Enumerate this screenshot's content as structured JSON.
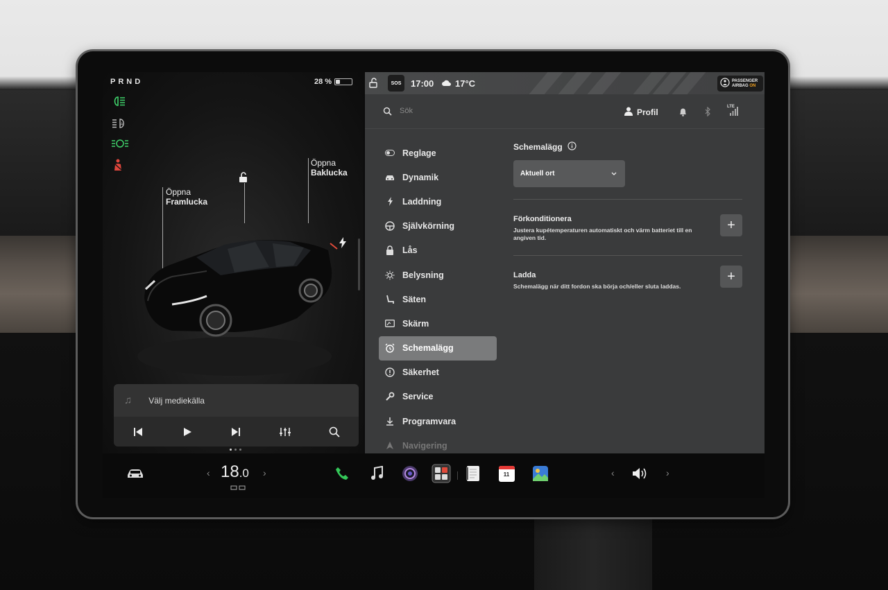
{
  "left_panel": {
    "gear": "PRND",
    "battery_percent": "28 %",
    "battery_level": 0.28,
    "labels": {
      "front_trunk_line1": "Öppna",
      "front_trunk_line2": "Framlucka",
      "rear_trunk_line1": "Öppna",
      "rear_trunk_line2": "Baklucka"
    },
    "telltales": [
      "headlight-icon",
      "auto-highbeam-icon",
      "parking-light-icon",
      "seatbelt-warning-icon"
    ],
    "media": {
      "source_label": "Välj mediekälla"
    }
  },
  "status_bar": {
    "time": "17:00",
    "temperature": "17°C",
    "sos": "SOS",
    "airbag_line1": "PASSENGER",
    "airbag_line2": "AIRBAG",
    "airbag_state": "ON"
  },
  "header": {
    "search_placeholder": "Sök",
    "profile": "Profil",
    "network": "LTE"
  },
  "menu": {
    "items": [
      {
        "label": "Reglage",
        "icon": "toggle-icon"
      },
      {
        "label": "Dynamik",
        "icon": "car-icon"
      },
      {
        "label": "Laddning",
        "icon": "bolt-icon"
      },
      {
        "label": "Självkörning",
        "icon": "steering-wheel-icon"
      },
      {
        "label": "Lås",
        "icon": "lock-icon"
      },
      {
        "label": "Belysning",
        "icon": "sun-icon"
      },
      {
        "label": "Säten",
        "icon": "seat-icon"
      },
      {
        "label": "Skärm",
        "icon": "screen-icon"
      },
      {
        "label": "Schemalägg",
        "icon": "alarm-clock-icon",
        "active": true
      },
      {
        "label": "Säkerhet",
        "icon": "info-circle-icon"
      },
      {
        "label": "Service",
        "icon": "wrench-icon"
      },
      {
        "label": "Programvara",
        "icon": "download-icon"
      },
      {
        "label": "Navigering",
        "icon": "navigation-icon"
      }
    ]
  },
  "content": {
    "section_title": "Schemalägg",
    "dropdown_value": "Aktuell ort",
    "rows": [
      {
        "title": "Förkonditionera",
        "desc": "Justera kupétemperaturen automatiskt och värm batteriet till en angiven tid."
      },
      {
        "title": "Ladda",
        "desc": "Schemalägg när ditt fordon ska börja och/eller sluta laddas."
      }
    ]
  },
  "dock": {
    "temperature_int": "18",
    "temperature_dec": ".0",
    "calendar_day": "11",
    "colors": {
      "phone": "#34c759",
      "calendar": "#e53935"
    }
  },
  "colors": {
    "telltale_green": "#3fd16a",
    "telltale_red": "#e0463c"
  }
}
